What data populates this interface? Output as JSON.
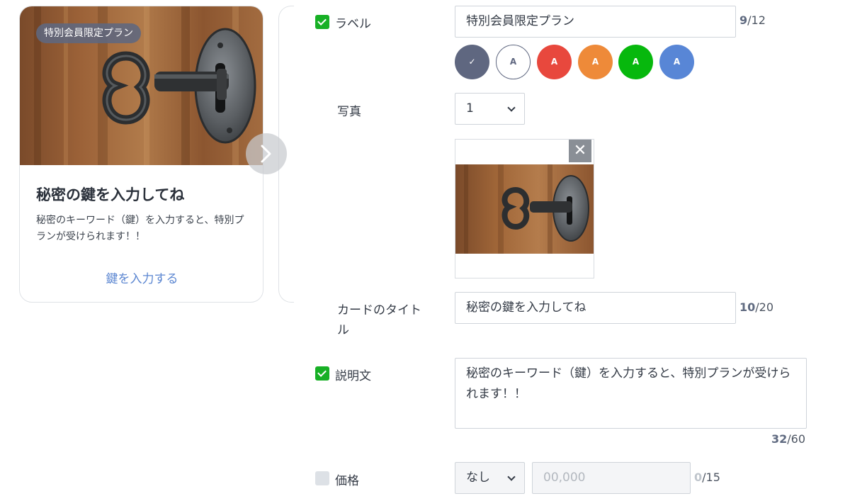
{
  "preview": {
    "badge": "特別会員限定プラン",
    "title": "秘密の鍵を入力してね",
    "description": "秘密のキーワード（鍵）を入力すると、特別プランが受けられます！！",
    "action_label": "鍵を入力する",
    "next_icon": "chevron-right-icon"
  },
  "form": {
    "label": {
      "checked": true,
      "caption": "ラベル",
      "value": "特別会員限定プラン",
      "count": "9",
      "max": "/12",
      "colors": [
        {
          "name": "slate",
          "hex": "#5f6780",
          "text": "✓",
          "selected": true
        },
        {
          "name": "white",
          "hex": "#ffffff",
          "text": "A"
        },
        {
          "name": "red",
          "hex": "#e8483d",
          "text": "A"
        },
        {
          "name": "orange",
          "hex": "#ee8a39",
          "text": "A"
        },
        {
          "name": "green",
          "hex": "#07b80d",
          "text": "A"
        },
        {
          "name": "blue",
          "hex": "#5886d6",
          "text": "A"
        }
      ]
    },
    "photo": {
      "caption": "写真",
      "selected": "1",
      "remove_label": "✕"
    },
    "card_title": {
      "caption": "カードのタイトル",
      "value": "秘密の鍵を入力してね",
      "count": "10",
      "max": "/20"
    },
    "description": {
      "checked": true,
      "caption": "説明文",
      "value": "秘密のキーワード（鍵）を入力すると、特別プランが受けられます！！",
      "count": "32",
      "max": "/60"
    },
    "price": {
      "checked": false,
      "caption": "価格",
      "currency": "なし",
      "placeholder": "00,000",
      "count": "0",
      "max": "/15"
    }
  }
}
